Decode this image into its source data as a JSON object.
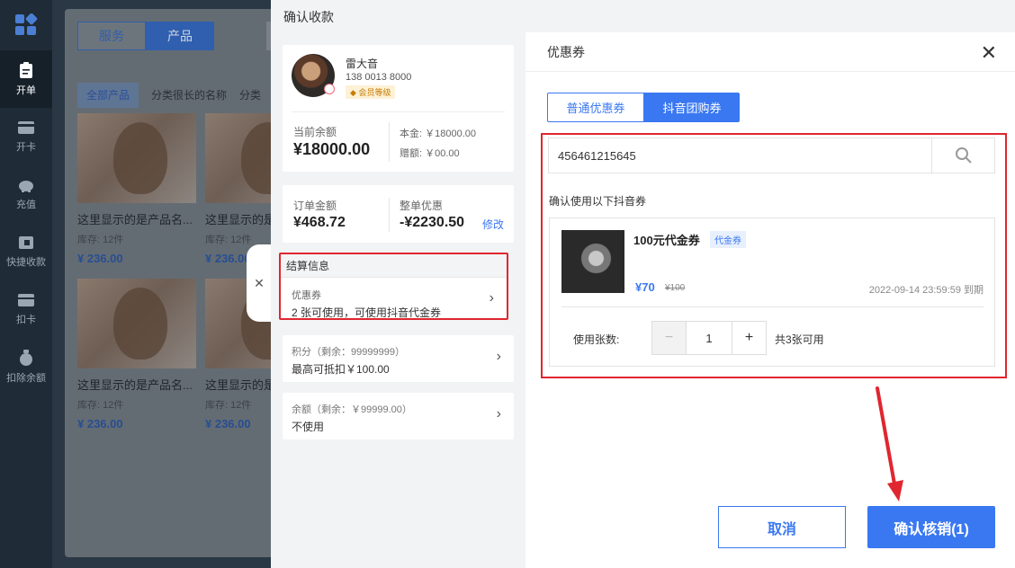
{
  "nav": {
    "items": [
      {
        "label": "开单",
        "icon": "clipboard-icon"
      },
      {
        "label": "开卡",
        "icon": "card-icon"
      },
      {
        "label": "充值",
        "icon": "piggy-bank-icon"
      },
      {
        "label": "快捷收款",
        "icon": "quick-pay-icon"
      },
      {
        "label": "扣卡",
        "icon": "deduct-card-icon"
      },
      {
        "label": "扣除余额",
        "icon": "money-bag-icon"
      }
    ]
  },
  "products": {
    "segments": [
      "服务",
      "产品"
    ],
    "categories": [
      "全部产品",
      "分类很长的名称",
      "分类"
    ],
    "cards": [
      {
        "name": "这里显示的是产品名...",
        "stock": "库存: 12件",
        "price": "¥ 236.00"
      },
      {
        "name": "这里显示的是产品名...",
        "stock": "库存: 12件",
        "price": "¥ 236.00"
      },
      {
        "name": "这里显示的是产品名...",
        "stock": "库存: 12件",
        "price": "¥ 236.00"
      },
      {
        "name": "这里显示的是产品名...",
        "stock": "库存: 12件",
        "price": "¥ 236.00"
      }
    ]
  },
  "drawer": {
    "title": "确认收款",
    "member": {
      "name": "雷大音",
      "phone": "138 0013 8000",
      "level": "会员等级",
      "balance_label": "当前余额",
      "balance": "¥18000.00",
      "principal": "本金: ￥18000.00",
      "gift": "赠额: ￥00.00"
    },
    "order": {
      "amount_label": "订单金额",
      "amount": "¥468.72",
      "discount_label": "整单优惠",
      "discount": "-¥2230.50",
      "edit": "修改"
    },
    "settlement": {
      "header": "结算信息",
      "coupon_label": "优惠券",
      "coupon_value": "2 张可使用，可使用抖音代金券"
    },
    "points": {
      "label": "积分（剩余：99999999）",
      "value": "最高可抵扣￥100.00"
    },
    "cash": {
      "label": "余额（剩余：￥99999.00）",
      "value": "不使用"
    }
  },
  "coupon_panel": {
    "title": "优惠券",
    "tabs": [
      "普通优惠券",
      "抖音团购券"
    ],
    "search_value": "456461215645",
    "confirm_tip": "确认使用以下抖音券",
    "coupon": {
      "title": "100元代金券",
      "tag": "代金券",
      "price": "¥70",
      "original_price": "¥100",
      "expire": "2022-09-14 23:59:59 到期",
      "qty_label": "使用张数:",
      "qty": "1",
      "available": "共3张可用"
    },
    "cancel": "取消",
    "confirm": "确认核销(1)"
  },
  "colors": {
    "accent": "#3a78f2",
    "highlight": "#e0262f"
  }
}
